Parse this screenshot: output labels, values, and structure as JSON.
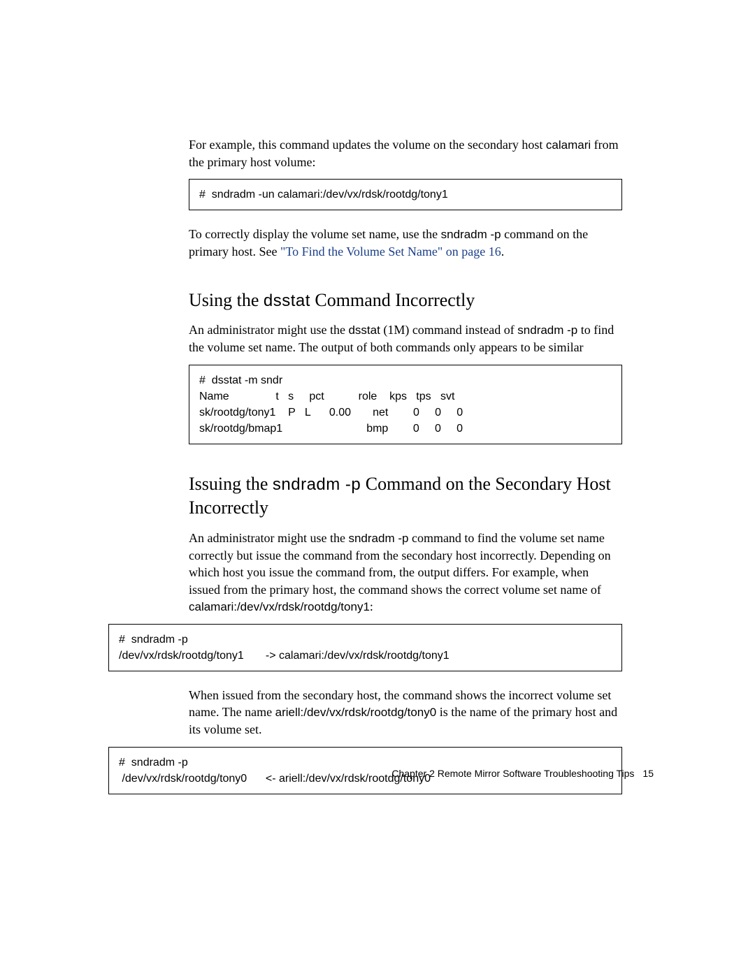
{
  "intro": {
    "p1_a": "For example, this command updates the volume on the secondary host ",
    "p1_code": "calamari",
    "p1_b": " from the primary host volume:"
  },
  "codebox1": "#  sndradm -un calamari:/dev/vx/rdsk/rootdg/tony1",
  "para2": {
    "a": "To correctly display the volume set name, use the ",
    "code": "sndradm -p",
    "b": " command on the primary host. See ",
    "link": "\"To Find the Volume Set Name\" on page 16",
    "c": "."
  },
  "section1": {
    "title_a": "Using the ",
    "title_code": "dsstat",
    "title_b": " Command Incorrectly",
    "p_a": "An administrator might use the ",
    "p_code1": "dsstat",
    "p_b": " (1M) command instead of ",
    "p_code2": "sndradm -p",
    "p_c": " to find the volume set name. The output of both commands only appears to be similar"
  },
  "codebox2": {
    "l1": "#  dsstat -m sndr",
    "l2": "Name               t   s     pct           role    kps   tps   svt",
    "l3": "sk/rootdg/tony1    P   L      0.00       net        0     0     0",
    "l4": "sk/rootdg/bmap1                           bmp        0     0     0"
  },
  "section2": {
    "title_a": "Issuing the ",
    "title_code": "sndradm -p",
    "title_b": " Command on the Secondary Host Incorrectly",
    "p_a": "An administrator might use the ",
    "p_code1": "sndradm -p",
    "p_b": " command to find the volume set name correctly but issue the command from the secondary host incorrectly. Depending on which host you issue the command from, the output differs. For example, when issued from the primary host, the command shows the correct volume set name of ",
    "p_code2": "calamari:/dev/vx/rdsk/rootdg/tony1",
    "p_c": ":"
  },
  "codebox3": {
    "l1": "#  sndradm -p",
    "l2": "/dev/vx/rdsk/rootdg/tony1       -> calamari:/dev/vx/rdsk/rootdg/tony1"
  },
  "para3": {
    "a": "When issued from the secondary host, the command shows the ",
    "i": "incorrect",
    "b": " volume set name. The name ",
    "code": "ariell:/dev/vx/rdsk/rootdg/tony0",
    "c": " is the name of the primary host and its volume set."
  },
  "codebox4": {
    "l1": "#  sndradm -p",
    "l2": " /dev/vx/rdsk/rootdg/tony0      <- ariell:/dev/vx/rdsk/rootdg/tony0"
  },
  "footer": {
    "chapter": "Chapter 2    Remote Mirror Software Troubleshooting Tips",
    "page": "15"
  }
}
